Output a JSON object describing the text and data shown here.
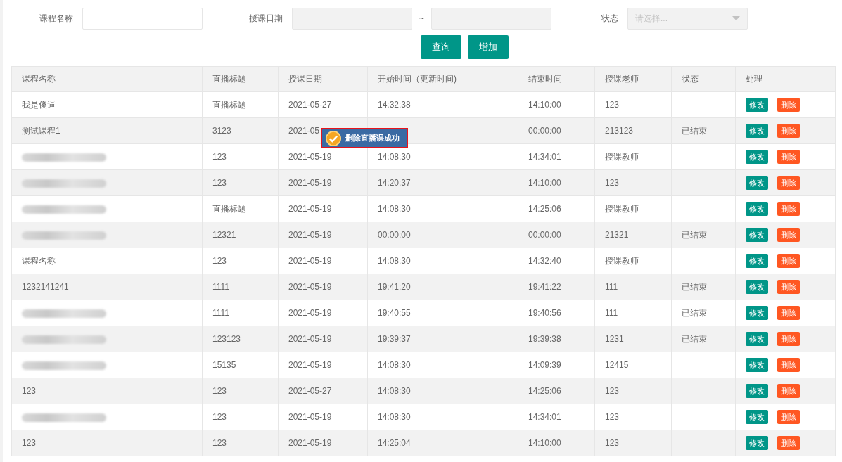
{
  "filters": {
    "course_name": {
      "label": "课程名称"
    },
    "date": {
      "label": "授课日期",
      "separator": "~"
    },
    "status": {
      "label": "状态",
      "placeholder": "请选择..."
    }
  },
  "buttons": [
    {
      "label": "查询"
    },
    {
      "label": "增加"
    }
  ],
  "table": {
    "columns": [
      "课程名称",
      "直播标题",
      "授课日期",
      "开始时间（更新时间)",
      "结束时间",
      "授课老师",
      "状态",
      "处理"
    ],
    "rows": [
      {
        "kind": "text",
        "name": "我是傻逼",
        "title": "直播标题",
        "date": "2021-05-27",
        "start": "14:32:38",
        "end": "14:10:00",
        "teacher": "123",
        "status": "",
        "actions": [
          {
            "kind": "edit",
            "label": "修改"
          },
          {
            "kind": "delete",
            "label": "删除"
          }
        ]
      },
      {
        "kind": "text",
        "name": "测试课程1",
        "title": "3123",
        "date": "2021-05",
        "start": "",
        "end": "00:00:00",
        "teacher": "213123",
        "status": "已结束",
        "actions": [
          {
            "kind": "edit",
            "label": "修改"
          },
          {
            "kind": "delete",
            "label": "删除"
          }
        ]
      },
      {
        "kind": "blurred",
        "title": "123",
        "date": "2021-05-19",
        "start": "14:08:30",
        "end": "14:34:01",
        "teacher": "授课教师",
        "status": "",
        "actions": [
          {
            "kind": "edit",
            "label": "修改"
          },
          {
            "kind": "delete",
            "label": "删除"
          }
        ]
      },
      {
        "kind": "blurred",
        "title": "123",
        "date": "2021-05-19",
        "start": "14:20:37",
        "end": "14:10:00",
        "teacher": "123",
        "status": "",
        "actions": [
          {
            "kind": "edit",
            "label": "修改"
          },
          {
            "kind": "delete",
            "label": "删除"
          }
        ]
      },
      {
        "kind": "blurred",
        "title": "直播标题",
        "date": "2021-05-19",
        "start": "14:08:30",
        "end": "14:25:06",
        "teacher": "授课教师",
        "status": "",
        "actions": [
          {
            "kind": "edit",
            "label": "修改"
          },
          {
            "kind": "delete",
            "label": "删除"
          }
        ]
      },
      {
        "kind": "blurred",
        "title": "12321",
        "date": "2021-05-19",
        "start": "00:00:00",
        "end": "00:00:00",
        "teacher": "21321",
        "status": "已结束",
        "actions": [
          {
            "kind": "edit",
            "label": "修改"
          },
          {
            "kind": "delete",
            "label": "删除"
          }
        ]
      },
      {
        "kind": "text",
        "name": "课程名称",
        "title": "123",
        "date": "2021-05-19",
        "start": "14:08:30",
        "end": "14:32:40",
        "teacher": "授课教师",
        "status": "",
        "actions": [
          {
            "kind": "edit",
            "label": "修改"
          },
          {
            "kind": "delete",
            "label": "删除"
          }
        ]
      },
      {
        "kind": "text",
        "name": "1232141241",
        "title": "1111",
        "date": "2021-05-19",
        "start": "19:41:20",
        "end": "19:41:22",
        "teacher": "111",
        "status": "已结束",
        "actions": [
          {
            "kind": "edit",
            "label": "修改"
          },
          {
            "kind": "delete",
            "label": "删除"
          }
        ]
      },
      {
        "kind": "blurred",
        "title": "1111",
        "date": "2021-05-19",
        "start": "19:40:55",
        "end": "19:40:56",
        "teacher": "111",
        "status": "已结束",
        "actions": [
          {
            "kind": "edit",
            "label": "修改"
          },
          {
            "kind": "delete",
            "label": "删除"
          }
        ]
      },
      {
        "kind": "blurred",
        "title": "123123",
        "date": "2021-05-19",
        "start": "19:39:37",
        "end": "19:39:38",
        "teacher": "1231",
        "status": "已结束",
        "actions": [
          {
            "kind": "edit",
            "label": "修改"
          },
          {
            "kind": "delete",
            "label": "删除"
          }
        ]
      },
      {
        "kind": "blurred",
        "title": "15135",
        "date": "2021-05-19",
        "start": "14:08:30",
        "end": "14:09:39",
        "teacher": "12415",
        "status": "",
        "actions": [
          {
            "kind": "edit",
            "label": "修改"
          },
          {
            "kind": "delete",
            "label": "删除"
          }
        ]
      },
      {
        "kind": "text",
        "name": "123",
        "title": "123",
        "date": "2021-05-27",
        "start": "14:08:30",
        "end": "14:25:06",
        "teacher": "123",
        "status": "",
        "actions": [
          {
            "kind": "edit",
            "label": "修改"
          },
          {
            "kind": "delete",
            "label": "删除"
          }
        ]
      },
      {
        "kind": "blurred",
        "title": "123",
        "date": "2021-05-19",
        "start": "14:08:30",
        "end": "14:34:01",
        "teacher": "123",
        "status": "",
        "actions": [
          {
            "kind": "edit",
            "label": "修改"
          },
          {
            "kind": "delete",
            "label": "删除"
          }
        ]
      },
      {
        "kind": "text",
        "name": "123",
        "title": "123",
        "date": "2021-05-19",
        "start": "14:25:04",
        "end": "14:10:00",
        "teacher": "123",
        "status": "",
        "actions": [
          {
            "kind": "edit",
            "label": "修改"
          },
          {
            "kind": "delete",
            "label": "删除"
          }
        ]
      }
    ]
  },
  "toast": {
    "message": "删除直播课成功"
  }
}
